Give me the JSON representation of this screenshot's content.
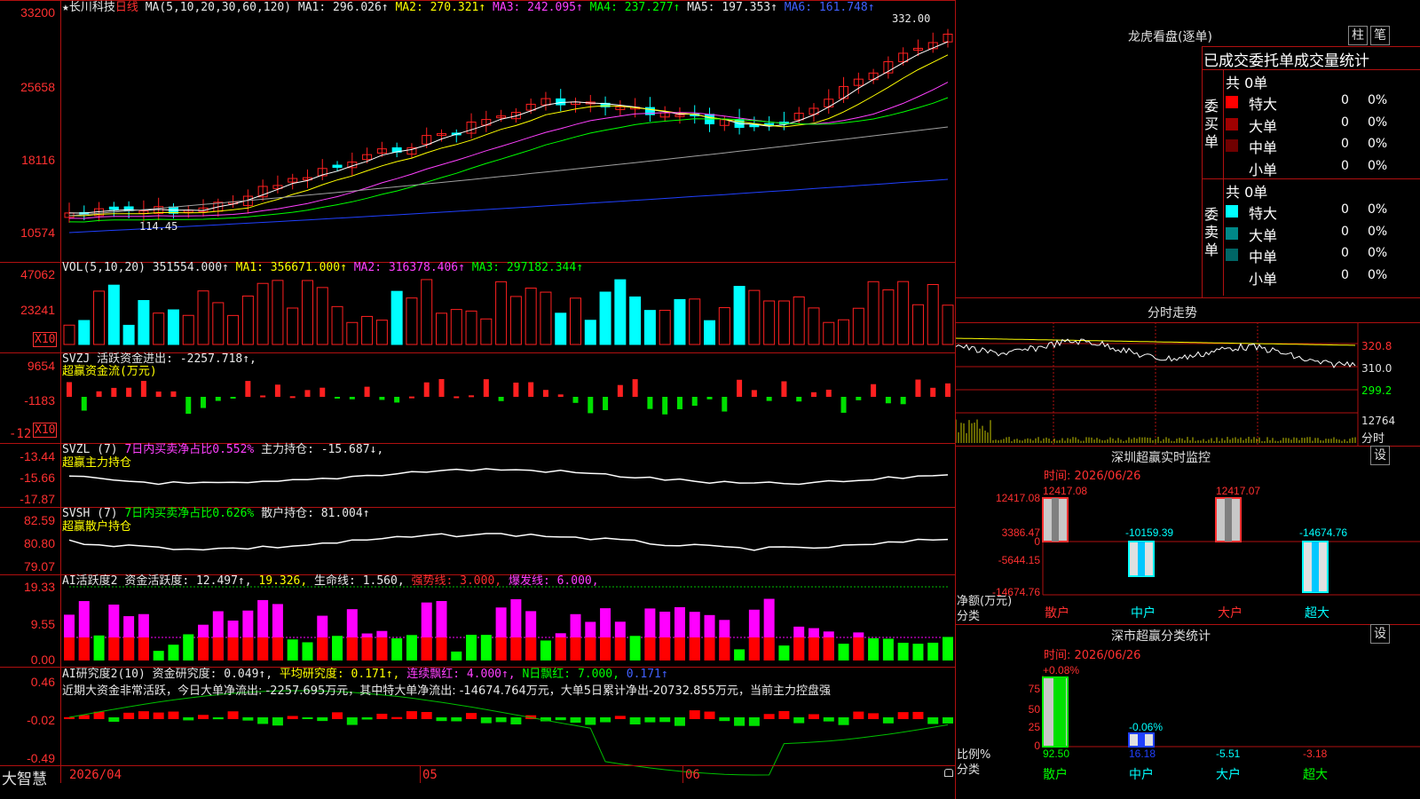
{
  "app": {
    "brand": "大智慧"
  },
  "stock": {
    "name": "长川科技",
    "period": "日线"
  },
  "main": {
    "star": "★",
    "ma_prefix": "MA(5,10,20,30,60,120)",
    "ma1": "MA1: 296.026↑",
    "ma2": "MA2: 270.321↑",
    "ma3": "MA3: 242.095↑",
    "ma4": "MA4: 237.277↑",
    "ma5": "MA5: 197.353↑",
    "ma6": "MA6: 161.748↑",
    "high_label": "332.00",
    "low_label": "114.45",
    "y_ticks": [
      "33200",
      "25658",
      "18116",
      "10574"
    ],
    "colors": {
      "up": "#ff2020",
      "down": "#00ffff",
      "ma1": "#ffffff",
      "ma2": "#ffff00",
      "ma3": "#ff40ff",
      "ma4": "#00ff00",
      "ma5": "#a0a0a0",
      "ma6": "#2040ff"
    }
  },
  "vol": {
    "title": "VOL(5,10,20)",
    "value": "351554.000↑",
    "ma1": "MA1: 356671.000↑",
    "ma2": "MA2: 316378.406↑",
    "ma3": "MA3: 297182.344↑",
    "y_ticks": [
      "47062",
      "23241"
    ],
    "unit": "X10"
  },
  "svzj": {
    "title": "SVZJ",
    "line1": "活跃资金进出: -2257.718↑,",
    "line2": "超赢资金流(万元)",
    "y_ticks": [
      "9654",
      "-1183",
      "-12"
    ],
    "unit": "X10"
  },
  "svzl": {
    "title": "SVZL (7)",
    "ratio": "7日内买卖净占比0.552%",
    "holding": "主力持仓: -15.687↓,",
    "line2": "超赢主力持仓",
    "y_ticks": [
      "-13.44",
      "-15.66",
      "-17.87"
    ]
  },
  "svsh": {
    "title": "SVSH (7)",
    "ratio": "7日内买卖净占比0.626%",
    "holding": "散户持仓: 81.004↑",
    "line2": "超赢散户持仓",
    "y_ticks": [
      "82.59",
      "80.80",
      "79.07"
    ]
  },
  "ai_active": {
    "title": "AI活跃度2",
    "v1": "资金活跃度: 12.497↑,",
    "v2": "19.326,",
    "v3": "生命线: 1.560,",
    "v4": "强势线: 3.000,",
    "v5": "爆发线: 6.000,",
    "y_ticks": [
      "19.33",
      "9.55",
      "0.00"
    ]
  },
  "ai_research": {
    "title": "AI研究度2(10)",
    "v1": "资金研究度: 0.049↑,",
    "v2": "平均研究度: 0.171↑,",
    "v3": "连续飘红: 4.000↑,",
    "v4": "N日飘红: 7.000,",
    "v5": "0.171↑",
    "comment": "近期大资金非常活跃，今日大单净流出: -2257.695万元，其中特大单净流出: -14674.764万元，大单5日累计净出-20732.855万元，当前主力控盘强",
    "y_ticks": [
      "0.46",
      "-0.02",
      "-0.49"
    ]
  },
  "x_axis": {
    "start": "2026/04",
    "m05": "05",
    "m06": "06"
  },
  "lhb": {
    "title": "龙虎看盘(逐单)",
    "btn1": "柱",
    "btn2": "笔",
    "header": "已成交委托单成交量统计",
    "buy_label": "委买单",
    "sell_label": "委卖单",
    "buy_total": "共 0单",
    "sell_total": "共 0单",
    "buy_rows": [
      {
        "name": "特大",
        "count": "0",
        "pct": "0%",
        "color": "#ff0000"
      },
      {
        "name": "大单",
        "count": "0",
        "pct": "0%",
        "color": "#a00000"
      },
      {
        "name": "中单",
        "count": "0",
        "pct": "0%",
        "color": "#700000"
      },
      {
        "name": "小单",
        "count": "0",
        "pct": "0%",
        "color": "#000000"
      }
    ],
    "sell_rows": [
      {
        "name": "特大",
        "count": "0",
        "pct": "0%",
        "color": "#00ffff"
      },
      {
        "name": "大单",
        "count": "0",
        "pct": "0%",
        "color": "#008888"
      },
      {
        "name": "中单",
        "count": "0",
        "pct": "0%",
        "color": "#006666"
      },
      {
        "name": "小单",
        "count": "0",
        "pct": "0%",
        "color": "#000000"
      }
    ]
  },
  "fenshi": {
    "title": "分时走势",
    "price_ticks": [
      "320.8",
      "310.0",
      "299.2"
    ],
    "vol_tick": "12764",
    "vol_unit": "分时"
  },
  "sz_monitor": {
    "title": "深圳超赢实时监控",
    "btn": "设",
    "time": "时间: 2026/06/26",
    "y_ticks": [
      "12417.08",
      "3386.47",
      "0",
      "-5644.15",
      "-14674.76"
    ],
    "ylabel1": "净额(万元)",
    "ylabel2": "分类",
    "categories": [
      "散户",
      "中户",
      "大户",
      "超大"
    ],
    "bar_labels": [
      "12417.08",
      "-10159.39",
      "12417.07",
      "-14674.76"
    ]
  },
  "sz_classify": {
    "title": "深市超赢分类统计",
    "btn": "设",
    "time": "时间: 2026/06/26",
    "y_ticks": [
      "75",
      "50",
      "25",
      "0"
    ],
    "ylabel1": "比例%",
    "ylabel2": "分类",
    "categories": [
      "散户",
      "中户",
      "大户",
      "超大"
    ],
    "top_labels": [
      "+0.08%",
      "-0.06%"
    ],
    "values": [
      "92.50",
      "16.18",
      "-5.51",
      "-3.18"
    ]
  }
}
